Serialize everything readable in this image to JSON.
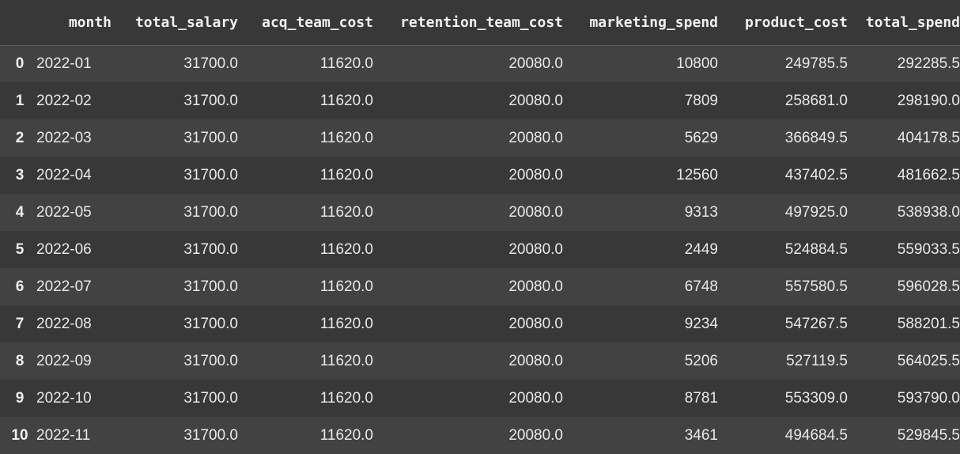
{
  "table": {
    "columns": [
      "month",
      "total_salary",
      "acq_team_cost",
      "retention_team_cost",
      "marketing_spend",
      "product_cost",
      "total_spend"
    ],
    "rows": [
      {
        "index": "0",
        "month": "2022-01",
        "total_salary": "31700.0",
        "acq_team_cost": "11620.0",
        "retention_team_cost": "20080.0",
        "marketing_spend": "10800",
        "product_cost": "249785.5",
        "total_spend": "292285.5"
      },
      {
        "index": "1",
        "month": "2022-02",
        "total_salary": "31700.0",
        "acq_team_cost": "11620.0",
        "retention_team_cost": "20080.0",
        "marketing_spend": "7809",
        "product_cost": "258681.0",
        "total_spend": "298190.0"
      },
      {
        "index": "2",
        "month": "2022-03",
        "total_salary": "31700.0",
        "acq_team_cost": "11620.0",
        "retention_team_cost": "20080.0",
        "marketing_spend": "5629",
        "product_cost": "366849.5",
        "total_spend": "404178.5"
      },
      {
        "index": "3",
        "month": "2022-04",
        "total_salary": "31700.0",
        "acq_team_cost": "11620.0",
        "retention_team_cost": "20080.0",
        "marketing_spend": "12560",
        "product_cost": "437402.5",
        "total_spend": "481662.5"
      },
      {
        "index": "4",
        "month": "2022-05",
        "total_salary": "31700.0",
        "acq_team_cost": "11620.0",
        "retention_team_cost": "20080.0",
        "marketing_spend": "9313",
        "product_cost": "497925.0",
        "total_spend": "538938.0"
      },
      {
        "index": "5",
        "month": "2022-06",
        "total_salary": "31700.0",
        "acq_team_cost": "11620.0",
        "retention_team_cost": "20080.0",
        "marketing_spend": "2449",
        "product_cost": "524884.5",
        "total_spend": "559033.5"
      },
      {
        "index": "6",
        "month": "2022-07",
        "total_salary": "31700.0",
        "acq_team_cost": "11620.0",
        "retention_team_cost": "20080.0",
        "marketing_spend": "6748",
        "product_cost": "557580.5",
        "total_spend": "596028.5"
      },
      {
        "index": "7",
        "month": "2022-08",
        "total_salary": "31700.0",
        "acq_team_cost": "11620.0",
        "retention_team_cost": "20080.0",
        "marketing_spend": "9234",
        "product_cost": "547267.5",
        "total_spend": "588201.5"
      },
      {
        "index": "8",
        "month": "2022-09",
        "total_salary": "31700.0",
        "acq_team_cost": "11620.0",
        "retention_team_cost": "20080.0",
        "marketing_spend": "5206",
        "product_cost": "527119.5",
        "total_spend": "564025.5"
      },
      {
        "index": "9",
        "month": "2022-10",
        "total_salary": "31700.0",
        "acq_team_cost": "11620.0",
        "retention_team_cost": "20080.0",
        "marketing_spend": "8781",
        "product_cost": "553309.0",
        "total_spend": "593790.0"
      },
      {
        "index": "10",
        "month": "2022-11",
        "total_salary": "31700.0",
        "acq_team_cost": "11620.0",
        "retention_team_cost": "20080.0",
        "marketing_spend": "3461",
        "product_cost": "494684.5",
        "total_spend": "529845.5"
      }
    ]
  },
  "colors": {
    "background": "#383838",
    "row_alt": "#424242",
    "text": "#e8e8e8",
    "header_border": "#5a5a5a"
  }
}
